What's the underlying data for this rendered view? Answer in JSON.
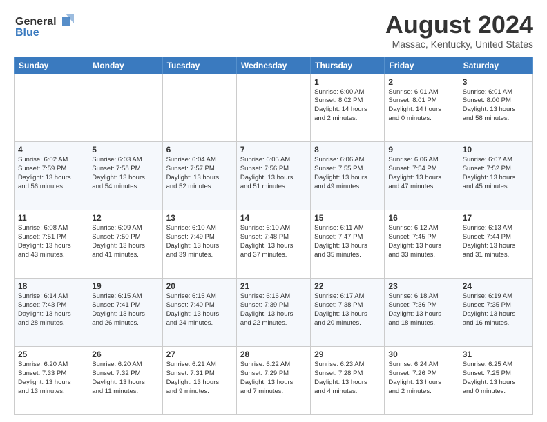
{
  "header": {
    "logo_line1": "General",
    "logo_line2": "Blue",
    "month_year": "August 2024",
    "location": "Massac, Kentucky, United States"
  },
  "weekdays": [
    "Sunday",
    "Monday",
    "Tuesday",
    "Wednesday",
    "Thursday",
    "Friday",
    "Saturday"
  ],
  "weeks": [
    [
      {
        "day": "",
        "info": ""
      },
      {
        "day": "",
        "info": ""
      },
      {
        "day": "",
        "info": ""
      },
      {
        "day": "",
        "info": ""
      },
      {
        "day": "1",
        "info": "Sunrise: 6:00 AM\nSunset: 8:02 PM\nDaylight: 14 hours\nand 2 minutes."
      },
      {
        "day": "2",
        "info": "Sunrise: 6:01 AM\nSunset: 8:01 PM\nDaylight: 14 hours\nand 0 minutes."
      },
      {
        "day": "3",
        "info": "Sunrise: 6:01 AM\nSunset: 8:00 PM\nDaylight: 13 hours\nand 58 minutes."
      }
    ],
    [
      {
        "day": "4",
        "info": "Sunrise: 6:02 AM\nSunset: 7:59 PM\nDaylight: 13 hours\nand 56 minutes."
      },
      {
        "day": "5",
        "info": "Sunrise: 6:03 AM\nSunset: 7:58 PM\nDaylight: 13 hours\nand 54 minutes."
      },
      {
        "day": "6",
        "info": "Sunrise: 6:04 AM\nSunset: 7:57 PM\nDaylight: 13 hours\nand 52 minutes."
      },
      {
        "day": "7",
        "info": "Sunrise: 6:05 AM\nSunset: 7:56 PM\nDaylight: 13 hours\nand 51 minutes."
      },
      {
        "day": "8",
        "info": "Sunrise: 6:06 AM\nSunset: 7:55 PM\nDaylight: 13 hours\nand 49 minutes."
      },
      {
        "day": "9",
        "info": "Sunrise: 6:06 AM\nSunset: 7:54 PM\nDaylight: 13 hours\nand 47 minutes."
      },
      {
        "day": "10",
        "info": "Sunrise: 6:07 AM\nSunset: 7:52 PM\nDaylight: 13 hours\nand 45 minutes."
      }
    ],
    [
      {
        "day": "11",
        "info": "Sunrise: 6:08 AM\nSunset: 7:51 PM\nDaylight: 13 hours\nand 43 minutes."
      },
      {
        "day": "12",
        "info": "Sunrise: 6:09 AM\nSunset: 7:50 PM\nDaylight: 13 hours\nand 41 minutes."
      },
      {
        "day": "13",
        "info": "Sunrise: 6:10 AM\nSunset: 7:49 PM\nDaylight: 13 hours\nand 39 minutes."
      },
      {
        "day": "14",
        "info": "Sunrise: 6:10 AM\nSunset: 7:48 PM\nDaylight: 13 hours\nand 37 minutes."
      },
      {
        "day": "15",
        "info": "Sunrise: 6:11 AM\nSunset: 7:47 PM\nDaylight: 13 hours\nand 35 minutes."
      },
      {
        "day": "16",
        "info": "Sunrise: 6:12 AM\nSunset: 7:45 PM\nDaylight: 13 hours\nand 33 minutes."
      },
      {
        "day": "17",
        "info": "Sunrise: 6:13 AM\nSunset: 7:44 PM\nDaylight: 13 hours\nand 31 minutes."
      }
    ],
    [
      {
        "day": "18",
        "info": "Sunrise: 6:14 AM\nSunset: 7:43 PM\nDaylight: 13 hours\nand 28 minutes."
      },
      {
        "day": "19",
        "info": "Sunrise: 6:15 AM\nSunset: 7:41 PM\nDaylight: 13 hours\nand 26 minutes."
      },
      {
        "day": "20",
        "info": "Sunrise: 6:15 AM\nSunset: 7:40 PM\nDaylight: 13 hours\nand 24 minutes."
      },
      {
        "day": "21",
        "info": "Sunrise: 6:16 AM\nSunset: 7:39 PM\nDaylight: 13 hours\nand 22 minutes."
      },
      {
        "day": "22",
        "info": "Sunrise: 6:17 AM\nSunset: 7:38 PM\nDaylight: 13 hours\nand 20 minutes."
      },
      {
        "day": "23",
        "info": "Sunrise: 6:18 AM\nSunset: 7:36 PM\nDaylight: 13 hours\nand 18 minutes."
      },
      {
        "day": "24",
        "info": "Sunrise: 6:19 AM\nSunset: 7:35 PM\nDaylight: 13 hours\nand 16 minutes."
      }
    ],
    [
      {
        "day": "25",
        "info": "Sunrise: 6:20 AM\nSunset: 7:33 PM\nDaylight: 13 hours\nand 13 minutes."
      },
      {
        "day": "26",
        "info": "Sunrise: 6:20 AM\nSunset: 7:32 PM\nDaylight: 13 hours\nand 11 minutes."
      },
      {
        "day": "27",
        "info": "Sunrise: 6:21 AM\nSunset: 7:31 PM\nDaylight: 13 hours\nand 9 minutes."
      },
      {
        "day": "28",
        "info": "Sunrise: 6:22 AM\nSunset: 7:29 PM\nDaylight: 13 hours\nand 7 minutes."
      },
      {
        "day": "29",
        "info": "Sunrise: 6:23 AM\nSunset: 7:28 PM\nDaylight: 13 hours\nand 4 minutes."
      },
      {
        "day": "30",
        "info": "Sunrise: 6:24 AM\nSunset: 7:26 PM\nDaylight: 13 hours\nand 2 minutes."
      },
      {
        "day": "31",
        "info": "Sunrise: 6:25 AM\nSunset: 7:25 PM\nDaylight: 13 hours\nand 0 minutes."
      }
    ]
  ]
}
